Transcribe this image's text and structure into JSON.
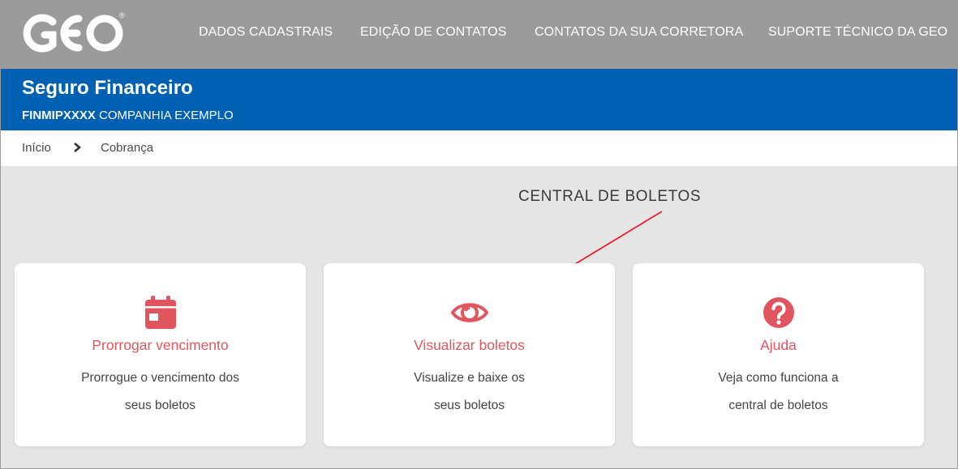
{
  "brand": {
    "logo_text": "GEO",
    "registered": "®"
  },
  "nav": {
    "items": [
      {
        "label": "DADOS CADASTRAIS"
      },
      {
        "label": "EDIÇÃO DE CONTATOS"
      },
      {
        "label": "CONTATOS DA SUA CORRETORA"
      },
      {
        "label": "SUPORTE TÉCNICO DA GEO"
      }
    ]
  },
  "product": {
    "title": "Seguro Financeiro",
    "code": "FINMIPXXXX",
    "company": "COMPANHIA EXEMPLO"
  },
  "breadcrumb": {
    "home": "Início",
    "current": "Cobrança"
  },
  "annotation": {
    "label": "CENTRAL DE BOLETOS"
  },
  "cards": [
    {
      "icon": "calendar-icon",
      "title": "Prorrogar vencimento",
      "desc_line1": "Prorrogue o vencimento dos",
      "desc_line2": "seus boletos"
    },
    {
      "icon": "eye-icon",
      "title": "Visualizar boletos",
      "desc_line1": "Visualize e baixe os",
      "desc_line2": "seus boletos"
    },
    {
      "icon": "question-icon",
      "title": "Ajuda",
      "desc_line1": "Veja como funciona a",
      "desc_line2": "central de boletos"
    }
  ],
  "colors": {
    "topbar": "#9b9b9b",
    "product_bar": "#0060b4",
    "accent": "#e0555e",
    "annotation_arrow": "#e8202a",
    "content_bg": "#e6e5e6"
  }
}
